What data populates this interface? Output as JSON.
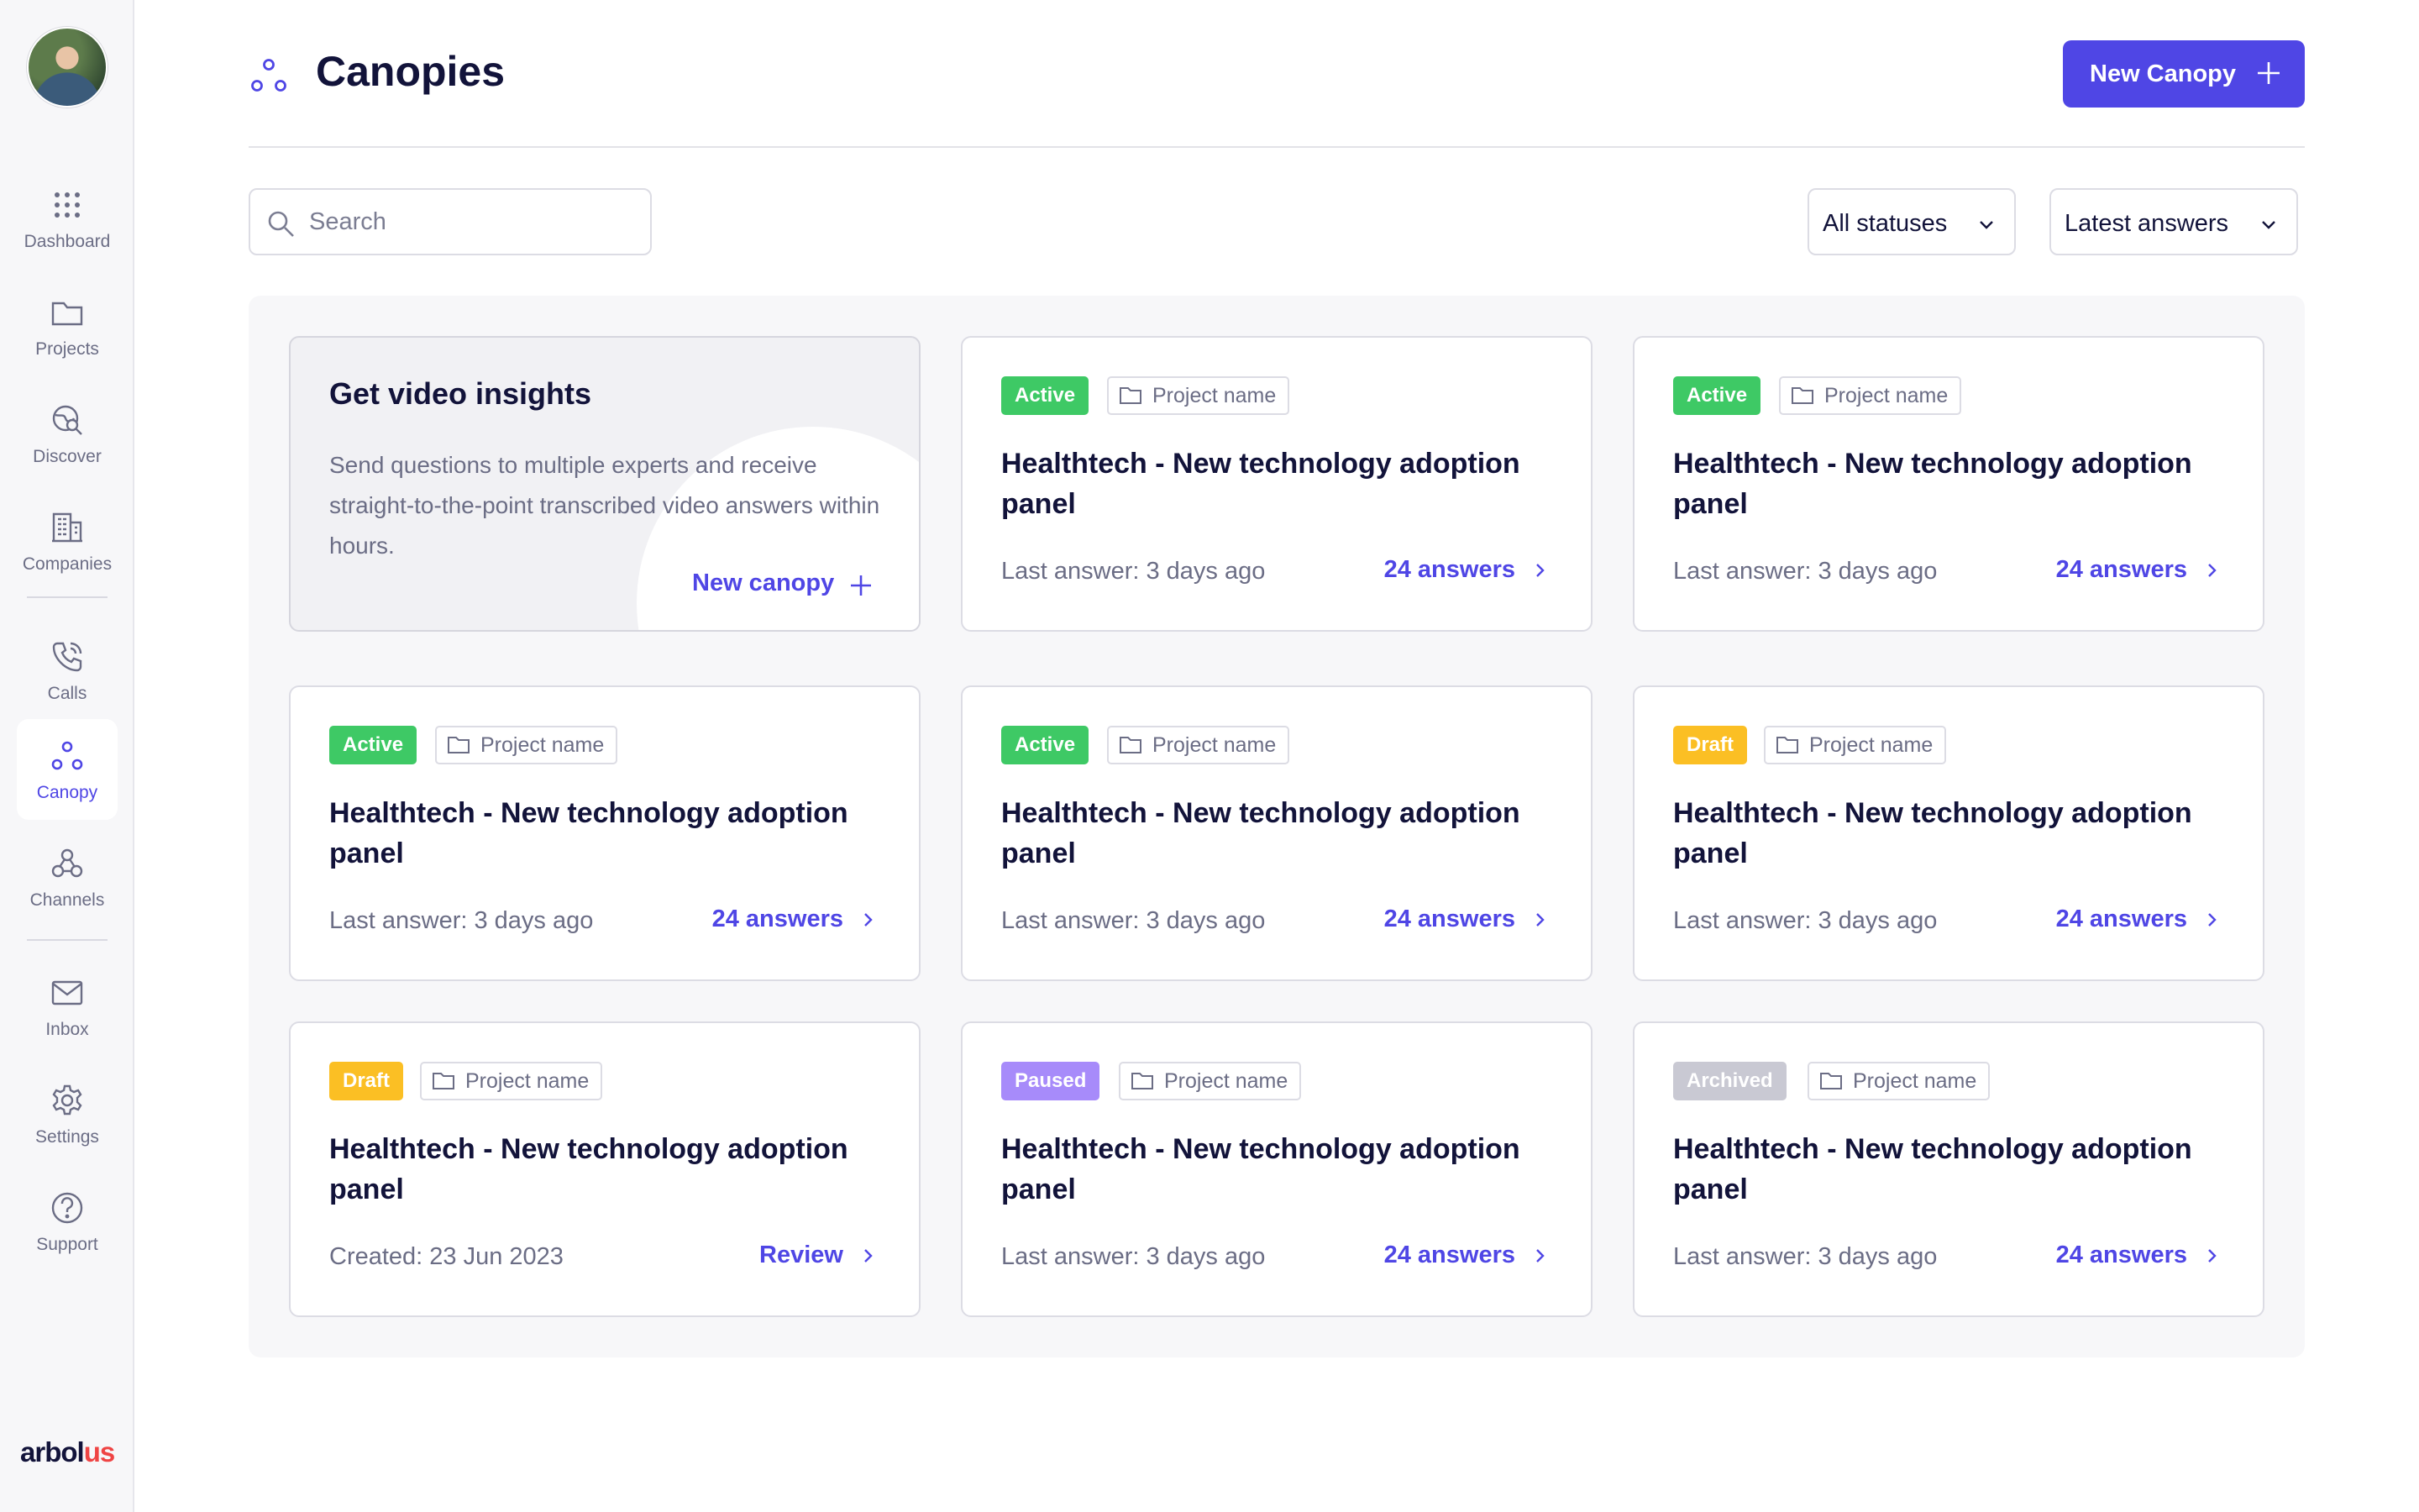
{
  "sidebar": {
    "items": [
      {
        "label": "Dashboard",
        "icon": "grid-dots-icon"
      },
      {
        "label": "Projects",
        "icon": "folder-icon"
      },
      {
        "label": "Discover",
        "icon": "globe-search-icon"
      },
      {
        "label": "Companies",
        "icon": "building-icon"
      },
      {
        "label": "Calls",
        "icon": "phone-icon"
      },
      {
        "label": "Canopy",
        "icon": "canopy-icon"
      },
      {
        "label": "Channels",
        "icon": "webhook-icon"
      },
      {
        "label": "Inbox",
        "icon": "mail-icon"
      },
      {
        "label": "Settings",
        "icon": "gear-icon"
      },
      {
        "label": "Support",
        "icon": "help-icon"
      }
    ],
    "active": "Canopy",
    "logo": {
      "prefix": "arbol",
      "accent": "us"
    }
  },
  "header": {
    "title": "Canopies",
    "new_button": "New Canopy"
  },
  "toolbar": {
    "search_placeholder": "Search",
    "status_filter": "All statuses",
    "sort": "Latest answers"
  },
  "promo": {
    "title": "Get video insights",
    "description": "Send questions to multiple experts and receive straight-to-the-point transcribed video answers within hours.",
    "link": "New canopy"
  },
  "cards": [
    {
      "status": "Active",
      "project": "Project name",
      "title": "Healthtech - New technology adoption panel",
      "meta": "Last answer: 3 days ago",
      "link": "24 answers"
    },
    {
      "status": "Active",
      "project": "Project name",
      "title": "Healthtech - New technology adoption panel",
      "meta": "Last answer: 3 days ago",
      "link": "24 answers"
    },
    {
      "status": "Active",
      "project": "Project name",
      "title": "Healthtech - New technology adoption panel",
      "meta": "Last answer: 3 days ago",
      "link": "24 answers"
    },
    {
      "status": "Active",
      "project": "Project name",
      "title": "Healthtech - New technology adoption panel",
      "meta": "Last answer: 3 days ago",
      "link": "24 answers"
    },
    {
      "status": "Draft",
      "project": "Project name",
      "title": "Healthtech - New technology adoption panel",
      "meta": "Last answer: 3 days ago",
      "link": "24 answers"
    },
    {
      "status": "Draft",
      "project": "Project name",
      "title": "Healthtech - New technology adoption panel",
      "meta": "Created: 23 Jun 2023",
      "link": "Review"
    },
    {
      "status": "Paused",
      "project": "Project name",
      "title": "Healthtech - New technology adoption panel",
      "meta": "Last answer: 3 days ago",
      "link": "24 answers"
    },
    {
      "status": "Archived",
      "project": "Project name",
      "title": "Healthtech - New technology adoption panel",
      "meta": "Last answer: 3 days ago",
      "link": "24 answers"
    }
  ],
  "colors": {
    "accent": "#4f46e5",
    "active": "#3ec965",
    "draft": "#fbbf24",
    "paused": "#a78bfa",
    "archived": "#c9c9d3"
  }
}
